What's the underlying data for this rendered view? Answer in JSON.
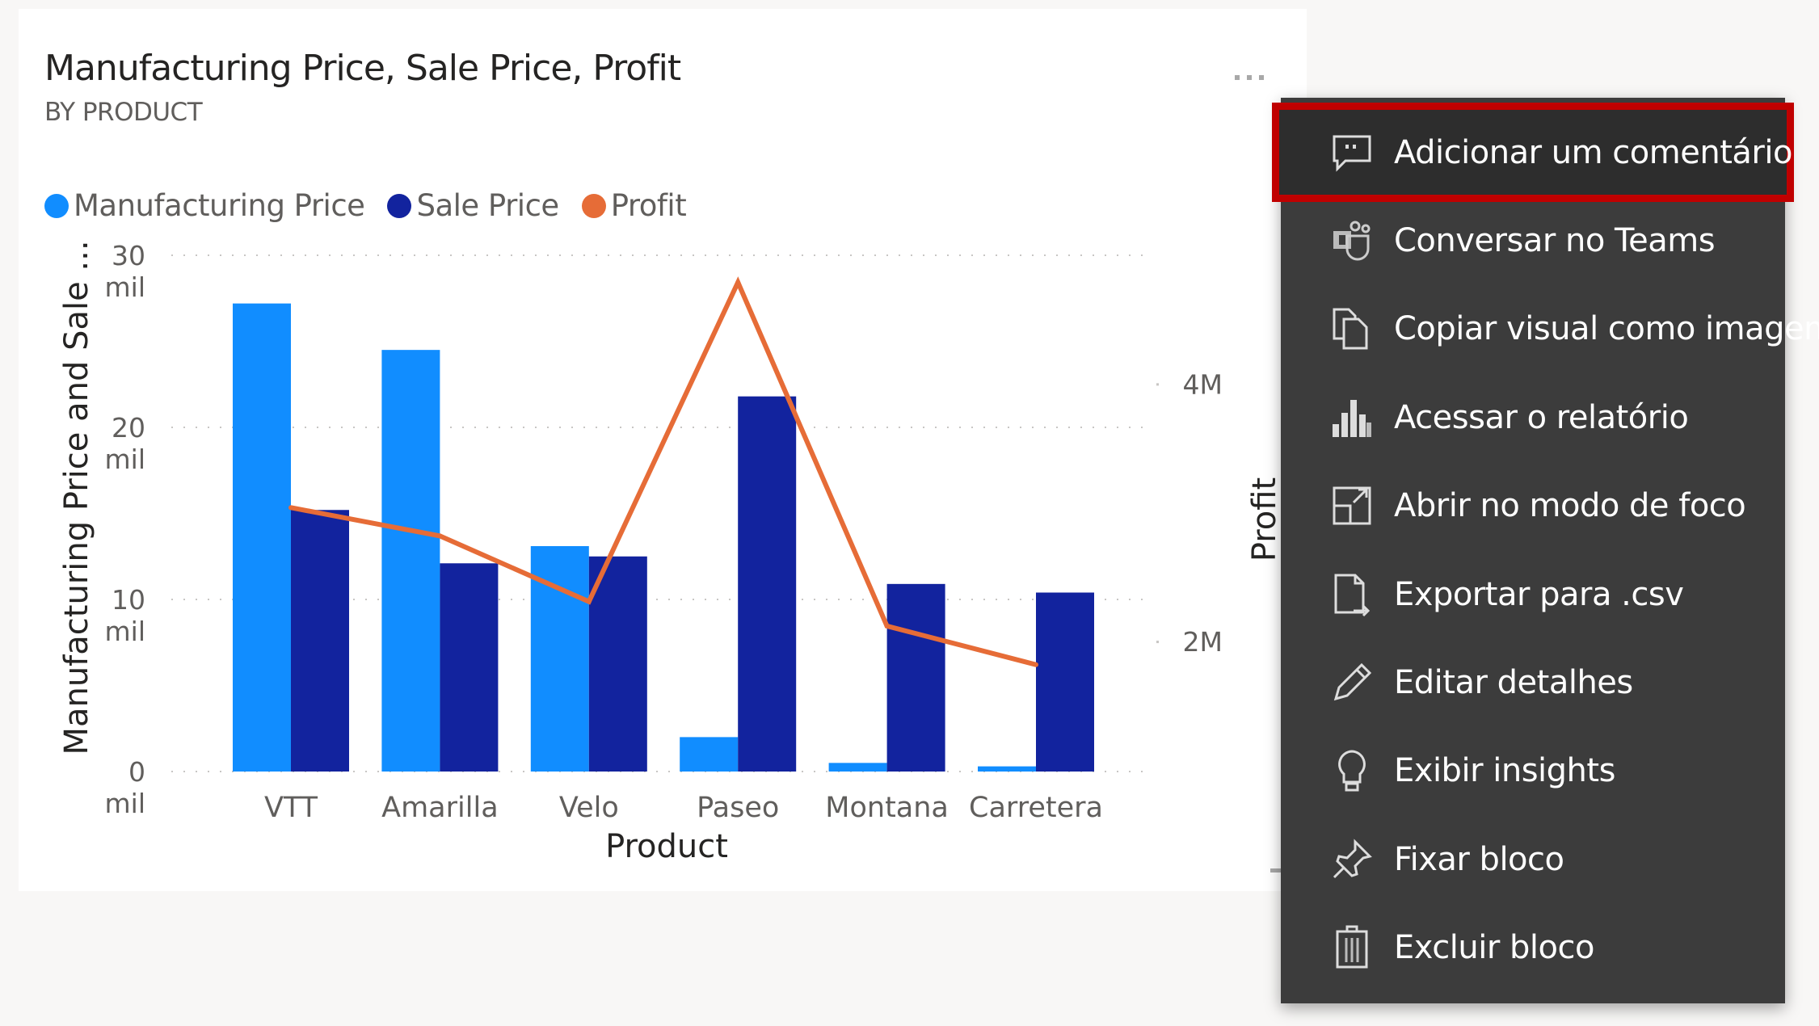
{
  "visual": {
    "title": "Manufacturing Price, Sale Price, Profit",
    "subtitle": "BY PRODUCT",
    "more_options_icon": "ellipsis-icon"
  },
  "legend": [
    {
      "label": "Manufacturing Price",
      "color": "#118dff"
    },
    {
      "label": "Sale Price",
      "color": "#12239e"
    },
    {
      "label": "Profit",
      "color": "#e66c37"
    }
  ],
  "chart_data": {
    "type": "bar+line",
    "title": "Manufacturing Price, Sale Price, Profit",
    "subtitle": "BY PRODUCT",
    "xlabel": "Product",
    "ylabel": "Manufacturing Price and Sale ...",
    "y2label": "Profit",
    "categories": [
      "VTT",
      "Amarilla",
      "Velo",
      "Paseo",
      "Montana",
      "Carretera"
    ],
    "series": [
      {
        "name": "Manufacturing Price",
        "type": "bar",
        "axis": "left",
        "color": "#118dff",
        "values": [
          27200,
          24500,
          13100,
          2000,
          500,
          300
        ]
      },
      {
        "name": "Sale Price",
        "type": "bar",
        "axis": "left",
        "color": "#12239e",
        "values": [
          15200,
          12100,
          12500,
          21800,
          10900,
          10400
        ]
      },
      {
        "name": "Profit",
        "type": "line",
        "axis": "right",
        "color": "#e66c37",
        "values": [
          3040000,
          2820000,
          2310000,
          4790000,
          2120000,
          1820000
        ]
      }
    ],
    "ylim": [
      0,
      30000
    ],
    "yticks": [
      {
        "value": 0,
        "label": [
          "0",
          "mil"
        ]
      },
      {
        "value": 10000,
        "label": [
          "10",
          "mil"
        ]
      },
      {
        "value": 20000,
        "label": [
          "20",
          "mil"
        ]
      },
      {
        "value": 30000,
        "label": [
          "30",
          "mil"
        ]
      }
    ],
    "y2lim": [
      990000,
      5000000
    ],
    "y2ticks": [
      {
        "value": 2000000,
        "label": "2M"
      },
      {
        "value": 4000000,
        "label": "4M"
      }
    ],
    "grid": true,
    "legend_position": "top-left"
  },
  "menu": {
    "items": [
      {
        "label": "Adicionar um comentário",
        "icon": "comment-icon",
        "highlighted": true
      },
      {
        "label": "Conversar no Teams",
        "icon": "teams-icon"
      },
      {
        "label": "Copiar visual como imagem",
        "icon": "copy-icon"
      },
      {
        "label": "Acessar o relatório",
        "icon": "report-icon"
      },
      {
        "label": "Abrir no modo de foco",
        "icon": "focus-mode-icon"
      },
      {
        "label": "Exportar para .csv",
        "icon": "export-icon"
      },
      {
        "label": "Editar detalhes",
        "icon": "pencil-icon"
      },
      {
        "label": "Exibir insights",
        "icon": "lightbulb-icon"
      },
      {
        "label": "Fixar bloco",
        "icon": "pin-icon"
      },
      {
        "label": "Excluir bloco",
        "icon": "trash-icon"
      }
    ]
  }
}
